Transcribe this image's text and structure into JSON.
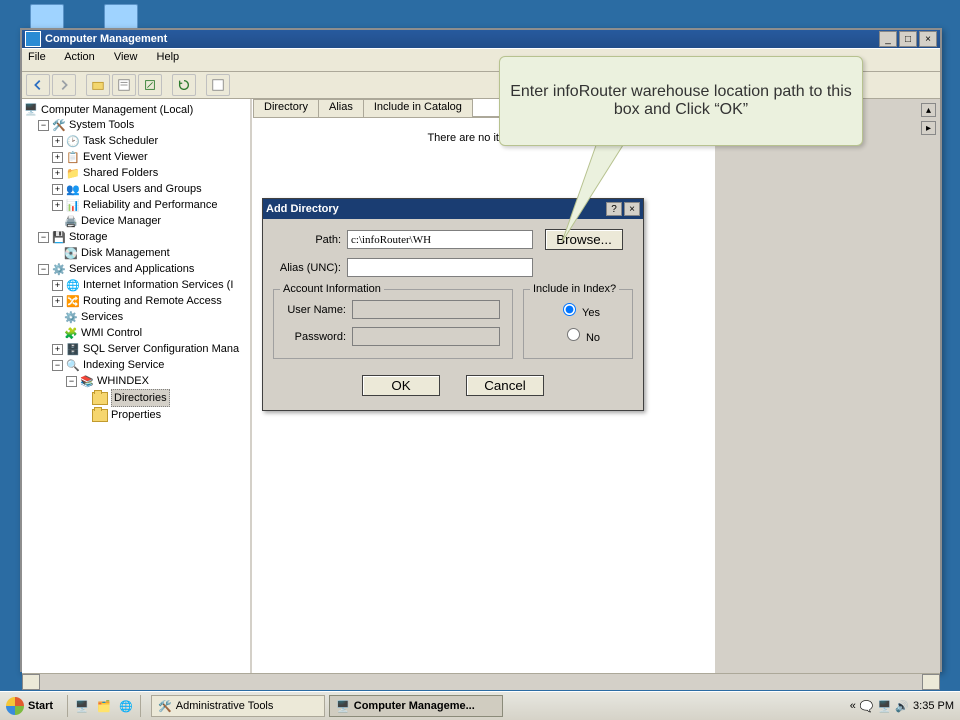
{
  "window": {
    "title": "Computer Management",
    "buttons": {
      "min": "_",
      "max": "□",
      "close": "×"
    }
  },
  "menu": {
    "file": "File",
    "action": "Action",
    "view": "View",
    "help": "Help"
  },
  "tree": {
    "root": "Computer Management (Local)",
    "systemTools": "System Tools",
    "taskScheduler": "Task Scheduler",
    "eventViewer": "Event Viewer",
    "sharedFolders": "Shared Folders",
    "localUsers": "Local Users and Groups",
    "reliability": "Reliability and Performance",
    "deviceManager": "Device Manager",
    "storage": "Storage",
    "diskManagement": "Disk Management",
    "servicesApps": "Services and Applications",
    "iis": "Internet Information Services (I",
    "routing": "Routing and Remote Access",
    "services": "Services",
    "wmi": "WMI Control",
    "sql": "SQL Server Configuration Mana",
    "indexing": "Indexing Service",
    "whindex": "WHINDEX",
    "directories": "Directories",
    "properties": "Properties"
  },
  "content": {
    "tabs": {
      "directory": "Directory",
      "alias": "Alias",
      "include": "Include in Catalog"
    },
    "empty": "There are no items to s"
  },
  "dialog": {
    "title": "Add Directory",
    "help": "?",
    "close": "×",
    "pathLabel": "Path:",
    "pathValue": "c:\\infoRouter\\WH",
    "aliasLabel": "Alias (UNC):",
    "aliasValue": "",
    "browse": "Browse...",
    "accountInfo": "Account Information",
    "userLabel": "User Name:",
    "userValue": "",
    "passLabel": "Password:",
    "passValue": "",
    "includeLegend": "Include in Index?",
    "yes": "Yes",
    "no": "No",
    "ok": "OK",
    "cancel": "Cancel"
  },
  "callout": "Enter infoRouter warehouse location path to this box and Click “OK”",
  "taskbar": {
    "start": "Start",
    "adminTools": "Administrative Tools",
    "compMgmt": "Computer Manageme...",
    "chev": "«",
    "time": "3:35 PM"
  }
}
